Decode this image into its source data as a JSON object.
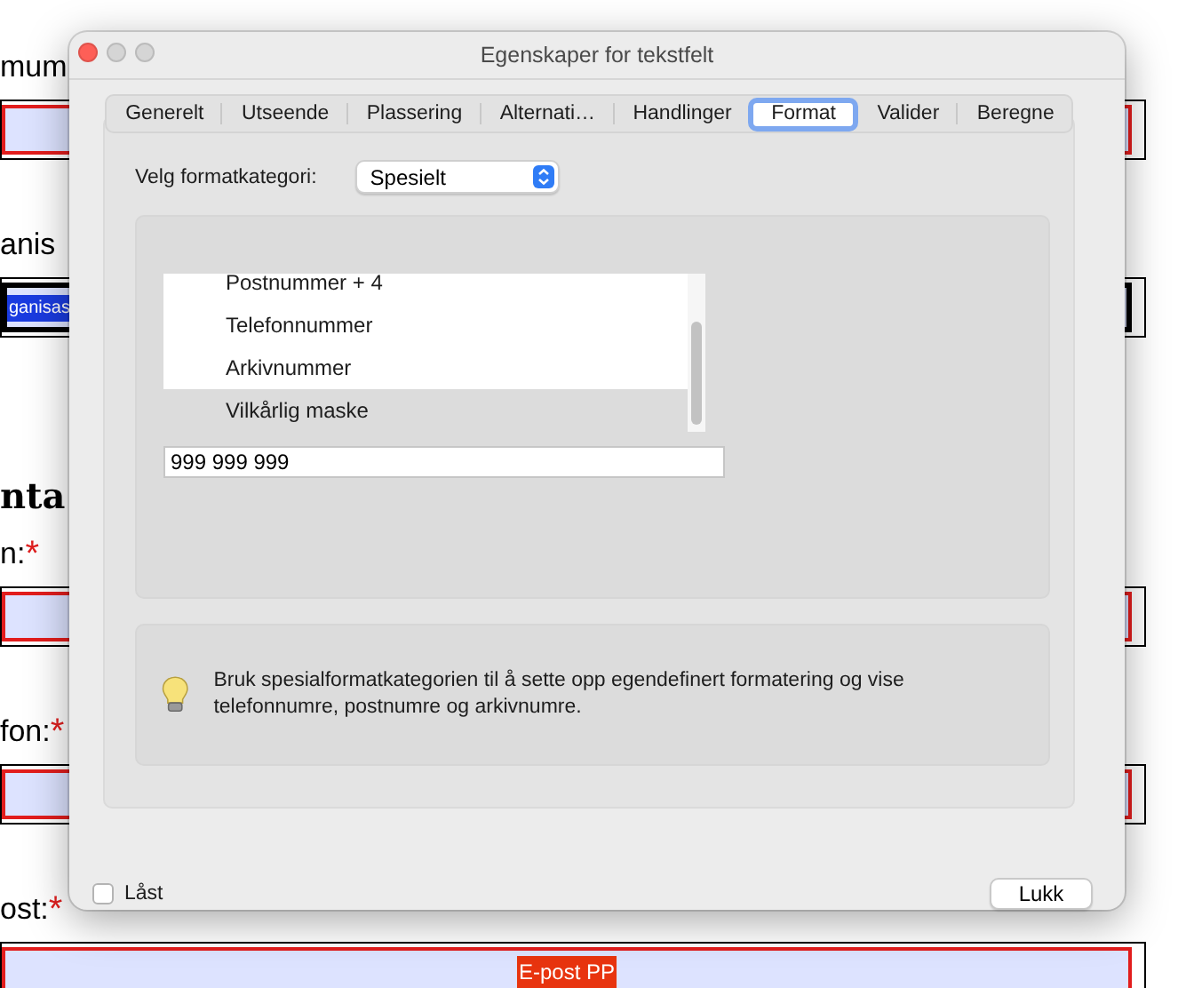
{
  "background_form": {
    "items": [
      {
        "kind": "label",
        "text": "mum"
      },
      {
        "kind": "field",
        "highlighted": true
      },
      {
        "kind": "label",
        "text": "anis"
      },
      {
        "kind": "field",
        "highlighted": false,
        "tag": "ganisas",
        "color": "#1a3be0"
      },
      {
        "kind": "heading",
        "text": "nta"
      },
      {
        "kind": "label",
        "text": "n:",
        "required": "*"
      },
      {
        "kind": "field",
        "highlighted": true
      },
      {
        "kind": "label",
        "text": "fon:",
        "required": "*"
      },
      {
        "kind": "field",
        "highlighted": true
      },
      {
        "kind": "label",
        "text": "ost:",
        "required": "*"
      },
      {
        "kind": "field",
        "highlighted": true,
        "tag": "E-post PP",
        "color": "#e8340f"
      }
    ]
  },
  "window": {
    "title": "Egenskaper for tekstfelt"
  },
  "tabs": [
    {
      "label": "Generelt",
      "selected": false
    },
    {
      "label": "Utseende",
      "selected": false
    },
    {
      "label": "Plassering",
      "selected": false
    },
    {
      "label": "Alternati…",
      "selected": false
    },
    {
      "label": "Handlinger",
      "selected": false
    },
    {
      "label": "Format",
      "selected": true
    },
    {
      "label": "Valider",
      "selected": false
    },
    {
      "label": "Beregne",
      "selected": false
    }
  ],
  "format_category": {
    "label": "Velg formatkategori:",
    "value": "Spesielt"
  },
  "special_formats": [
    {
      "label": "Postnummer + 4",
      "selected": false
    },
    {
      "label": "Telefonnummer",
      "selected": false
    },
    {
      "label": "Arkivnummer",
      "selected": false
    },
    {
      "label": "Vilkårlig maske",
      "selected": true
    }
  ],
  "mask_field": {
    "value": "999 999 999"
  },
  "hint": "Bruk spesialformatkategorien til å sette opp egendefinert formatering og vise telefonnumre, postnumre og arkivnumre.",
  "locked": {
    "label": "Låst",
    "checked": false
  },
  "close_button": "Lukk"
}
